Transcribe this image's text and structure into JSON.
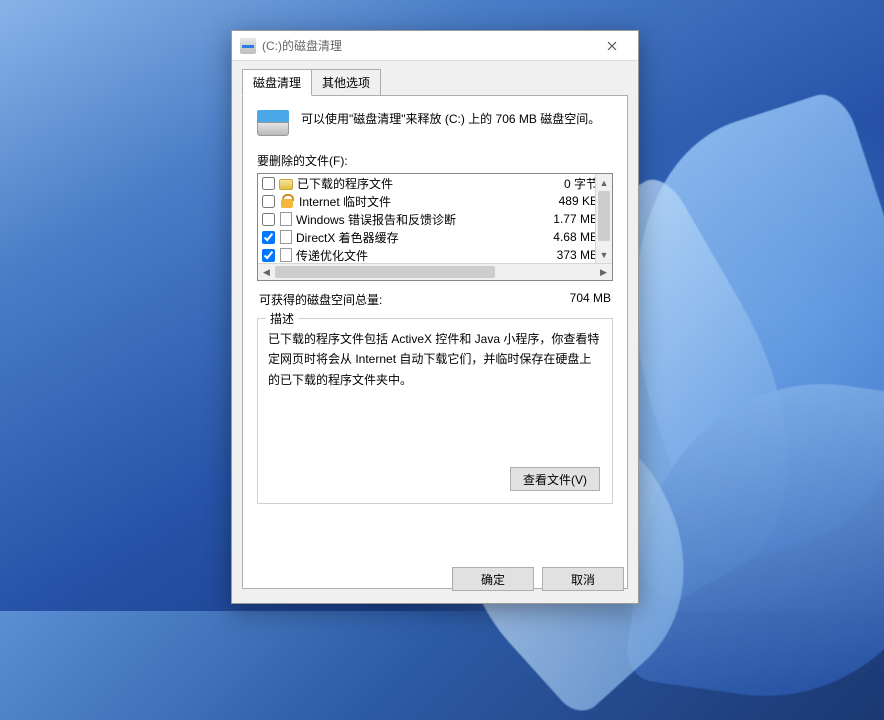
{
  "title": "(C:)的磁盘清理",
  "tabs": {
    "cleanup": "磁盘清理",
    "more": "其他选项"
  },
  "intro": "可以使用\"磁盘清理\"来释放  (C:) 上的 706 MB 磁盘空间。",
  "files_label": "要删除的文件(F):",
  "files": [
    {
      "checked": false,
      "icon": "folder",
      "name": "已下载的程序文件",
      "size": "0 字节"
    },
    {
      "checked": false,
      "icon": "lock",
      "name": "Internet 临时文件",
      "size": "489 KB"
    },
    {
      "checked": false,
      "icon": "file",
      "name": "Windows 错误报告和反馈诊断",
      "size": "1.77 MB"
    },
    {
      "checked": true,
      "icon": "file",
      "name": "DirectX 着色器缓存",
      "size": "4.68 MB"
    },
    {
      "checked": true,
      "icon": "file",
      "name": "传递优化文件",
      "size": "373 MB"
    }
  ],
  "total_label": "可获得的磁盘空间总量:",
  "total_value": "704 MB",
  "desc_label": "描述",
  "desc_text": "已下载的程序文件包括 ActiveX 控件和 Java 小程序，你查看特定网页时将会从 Internet 自动下载它们，并临时保存在硬盘上的已下载的程序文件夹中。",
  "view_files_btn": "查看文件(V)",
  "ok_btn": "确定",
  "cancel_btn": "取消"
}
